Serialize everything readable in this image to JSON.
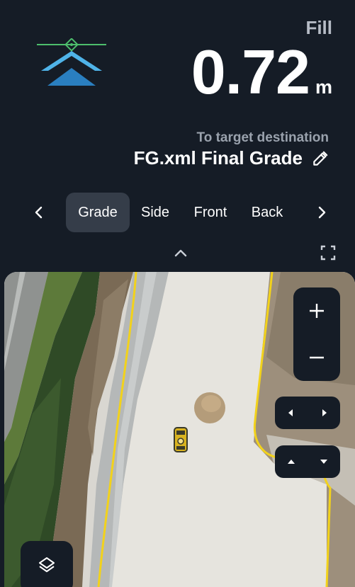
{
  "header": {
    "mode_label": "Fill",
    "value": "0.72",
    "unit": "m",
    "target_label": "To target destination",
    "file_name": "FG.xml Final Grade"
  },
  "tabs": {
    "items": [
      {
        "label": "Grade",
        "active": true
      },
      {
        "label": "Side",
        "active": false
      },
      {
        "label": "Front",
        "active": false
      },
      {
        "label": "Back",
        "active": false
      }
    ]
  },
  "icons": {
    "logo": "grade-chevrons-logo",
    "edit": "pencil-icon",
    "prev": "chevron-left-icon",
    "next": "chevron-right-icon",
    "collapse": "chevron-up-icon",
    "fullscreen": "fullscreen-icon",
    "zoom_in": "plus-icon",
    "zoom_out": "minus-icon",
    "pan_left": "caret-left-icon",
    "pan_right": "caret-right-icon",
    "pan_up": "caret-up-icon",
    "pan_down": "caret-down-icon",
    "layers": "layers-icon",
    "vehicle": "excavator-icon"
  },
  "colors": {
    "background": "#151c26",
    "panel": "#151c26",
    "active_tab": "#353d49",
    "logo_light_blue": "#4fb3e8",
    "logo_dark_blue": "#2a7fc0",
    "logo_line": "#4dbe6c",
    "boundary": "#f2d21b",
    "vehicle": "#d9b320"
  }
}
